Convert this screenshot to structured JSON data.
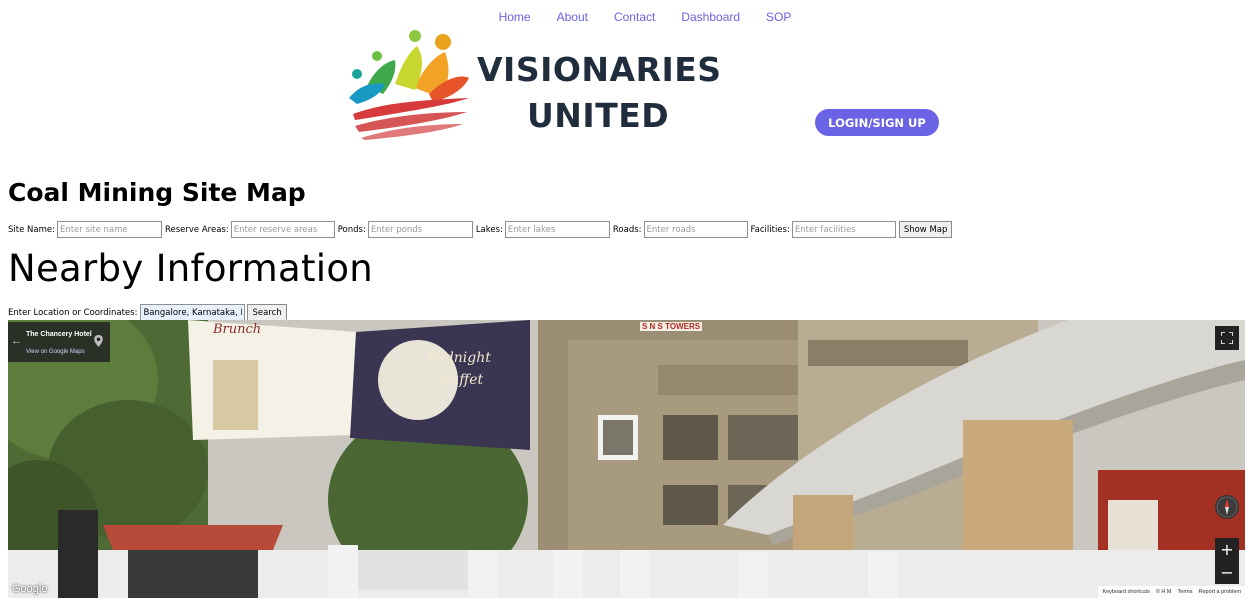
{
  "nav": {
    "items": [
      {
        "label": "Home"
      },
      {
        "label": "About"
      },
      {
        "label": "Contact"
      },
      {
        "label": "Dashboard"
      },
      {
        "label": "SOP"
      }
    ]
  },
  "logo": {
    "line1": "VISIONARIES",
    "line2": "UNITED"
  },
  "login_button": "LOGIN/SIGN UP",
  "coal_section": {
    "title": "Coal Mining Site Map",
    "fields": {
      "site_name": {
        "label": "Site Name:",
        "placeholder": "Enter site name"
      },
      "reserve_areas": {
        "label": "Reserve Areas:",
        "placeholder": "Enter reserve areas"
      },
      "ponds": {
        "label": "Ponds:",
        "placeholder": "Enter ponds"
      },
      "lakes": {
        "label": "Lakes:",
        "placeholder": "Enter lakes"
      },
      "roads": {
        "label": "Roads:",
        "placeholder": "Enter roads"
      },
      "facilities": {
        "label": "Facilities:",
        "placeholder": "Enter facilities"
      }
    },
    "show_map_button": "Show Map"
  },
  "nearby_section": {
    "title": "Nearby Information",
    "location_label": "Enter Location or Coordinates:",
    "location_value": "Bangalore, Karnataka, India",
    "search_button": "Search"
  },
  "street_view": {
    "place_name": "The Chancery Hotel",
    "view_link": "View on Google Maps",
    "google_logo": "Google",
    "footer": {
      "keyboard": "Keyboard shortcuts",
      "data": "© H M",
      "terms": "Terms",
      "report": "Report a problem"
    },
    "billboard": {
      "brunch": "Brunch",
      "midnight": "Midnight",
      "buffet": "Buffet",
      "tower_sign": "S N S TOWERS"
    }
  },
  "colors": {
    "accent": "#6b63e6",
    "nav_link": "#6a63e0",
    "logo_text": "#1f2d3d"
  }
}
